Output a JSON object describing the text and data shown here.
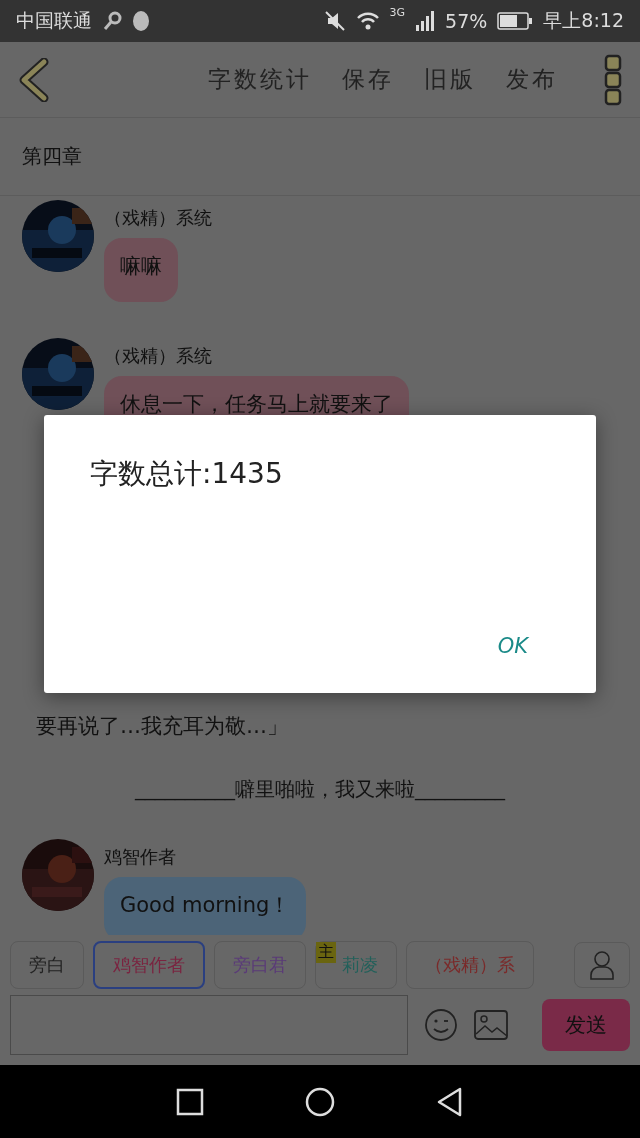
{
  "status_bar": {
    "carrier": "中国联通",
    "battery": "57%",
    "network": "3G",
    "time": "早上8:12"
  },
  "toolbar": {
    "actions": [
      "字数统计",
      "保存",
      "旧版",
      "发布"
    ]
  },
  "chapter": {
    "title": "第四章"
  },
  "messages": [
    {
      "kind": "message",
      "name": "（戏精）系统",
      "text": "嘛嘛",
      "color": "#705058"
    },
    {
      "kind": "message",
      "name": "（戏精）系统",
      "text": "休息一下，任务马上就要来了",
      "color": "#705058"
    },
    {
      "kind": "narration",
      "text": "要再说了…我充耳为敬…」"
    },
    {
      "kind": "divider",
      "text": "__________噼里啪啦，我又来啦_________"
    },
    {
      "kind": "message",
      "name": "鸡智作者",
      "text": "Good morning！",
      "color": "#4c6478"
    }
  ],
  "characters": [
    {
      "name": "旁白",
      "color": "#222222",
      "selected": false
    },
    {
      "name": "鸡智作者",
      "color": "#7a2440",
      "selected": true
    },
    {
      "name": "旁白君",
      "color": "#5a3a78",
      "selected": false
    },
    {
      "name": "莉凌",
      "color": "#22605a",
      "selected": false,
      "badge": "主"
    },
    {
      "name": "（戏精）系",
      "color": "#7a2a2a",
      "selected": false
    }
  ],
  "composer": {
    "send": "发送"
  },
  "dialog": {
    "message": "字数总计:1435",
    "button": "OK"
  }
}
